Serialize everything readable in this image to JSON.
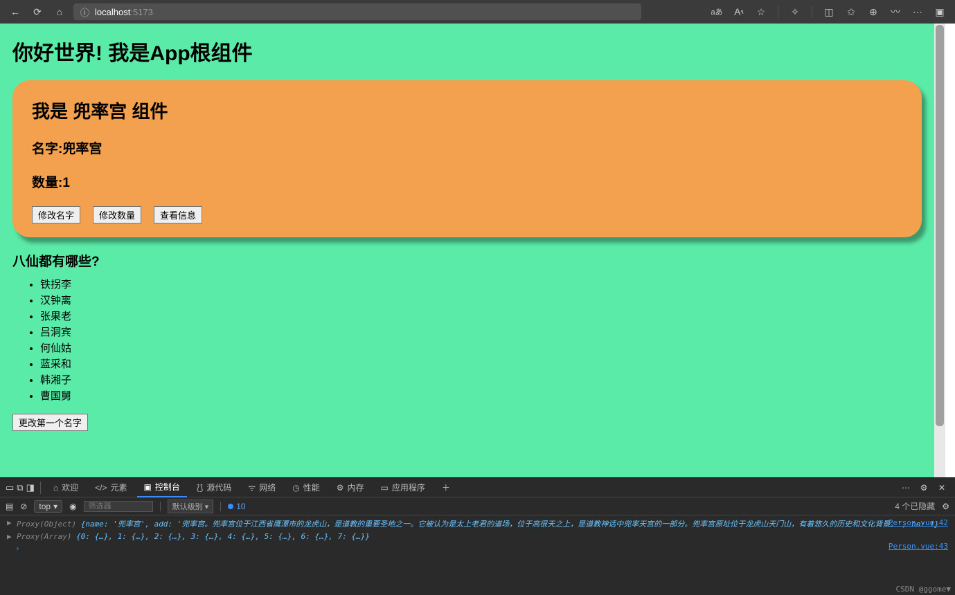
{
  "browser": {
    "url_host": "localhost",
    "url_port": ":5173",
    "translate_label": "aあ"
  },
  "page": {
    "title": "你好世界! 我是App根组件",
    "card": {
      "heading": "我是 兜率宫 组件",
      "name_label": "名字:兜率宫",
      "count_label": "数量:1",
      "btn_name": "修改名字",
      "btn_count": "修改数量",
      "btn_info": "查看信息"
    },
    "list_header": "八仙都有哪些?",
    "list": [
      "铁拐李",
      "汉钟离",
      "张果老",
      "吕洞宾",
      "何仙姑",
      "蓝采和",
      "韩湘子",
      "曹国舅"
    ],
    "btn_change_first": "更改第一个名字"
  },
  "devtools": {
    "tabs": {
      "welcome": "欢迎",
      "elements": "元素",
      "console": "控制台",
      "sources": "源代码",
      "network": "网络",
      "performance": "性能",
      "memory": "内存",
      "application": "应用程序"
    },
    "filter": {
      "top": "top",
      "filter_placeholder": "筛选器",
      "level": "默认级别",
      "issues_count": "10",
      "hidden_count": "4 个已隐藏"
    },
    "console_lines": {
      "line1_prefix": "Proxy(Object)",
      "line1_body": "{name: '兜率宫', add: '兜率宫。兜率宫位于江西省鹰潭市的龙虎山，是道教的重要圣地之一。它被认为是太上老君的道场，位于高很天之上，是道教神话中兜率天宫的一部分。兜率宫原址位于龙虎山天门山，有着悠久的历史和文化背景。', no: 1}",
      "line1_link": "Person.vue:42",
      "line2_prefix": "Proxy(Array)",
      "line2_body": "{0: {…}, 1: {…}, 2: {…}, 3: {…}, 4: {…}, 5: {…}, 6: {…}, 7: {…}}",
      "line2_link": "Person.vue:43"
    },
    "watermark": "CSDN @ggome▼"
  }
}
